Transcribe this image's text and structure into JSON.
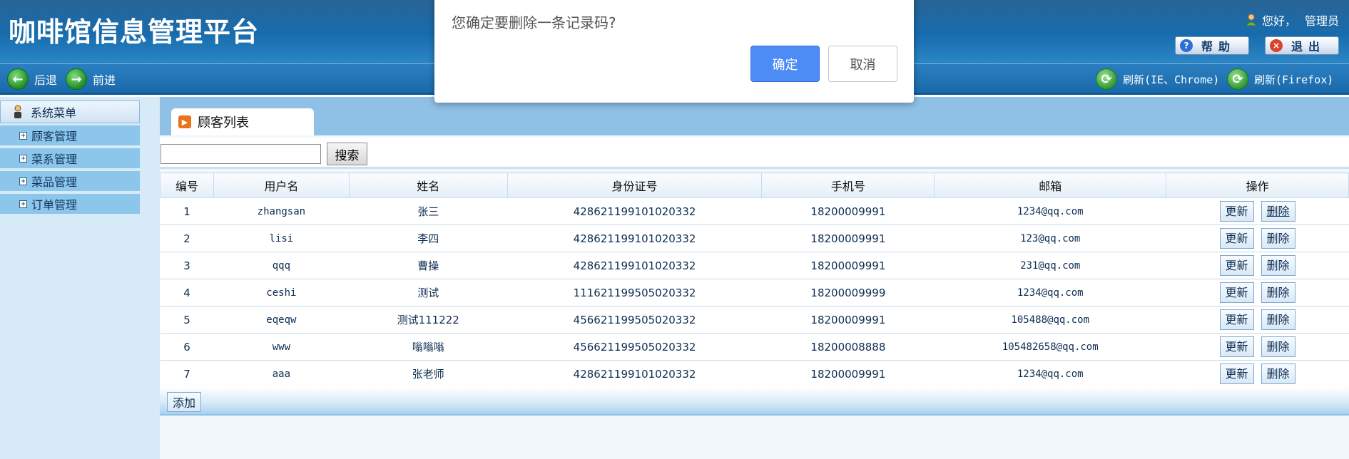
{
  "header": {
    "app_title": "咖啡馆信息管理平台",
    "greeting": "您好，",
    "username": "管理员",
    "help_label": "帮助",
    "logout_label": "退出"
  },
  "nav": {
    "back_label": "后退",
    "forward_label": "前进",
    "refresh_ie_label": "刷新(IE、Chrome)",
    "refresh_ff_label": "刷新(Firefox)"
  },
  "sidebar": {
    "menu_title": "系统菜单",
    "items": [
      {
        "label": "顾客管理"
      },
      {
        "label": "菜系管理"
      },
      {
        "label": "菜品管理"
      },
      {
        "label": "订单管理"
      }
    ]
  },
  "main": {
    "tab_label": "顾客列表",
    "search_placeholder": "",
    "search_value": "",
    "search_button": "搜索",
    "add_button": "添加",
    "columns": [
      "编号",
      "用户名",
      "姓名",
      "身份证号",
      "手机号",
      "邮箱",
      "操作"
    ],
    "rows": [
      {
        "id": "1",
        "username": "zhangsan",
        "name": "张三",
        "idcard": "428621199101020332",
        "phone": "18200009991",
        "email": "1234@qq.com"
      },
      {
        "id": "2",
        "username": "lisi",
        "name": "李四",
        "idcard": "428621199101020332",
        "phone": "18200009991",
        "email": "123@qq.com"
      },
      {
        "id": "3",
        "username": "qqq",
        "name": "曹操",
        "idcard": "428621199101020332",
        "phone": "18200009991",
        "email": "231@qq.com"
      },
      {
        "id": "4",
        "username": "ceshi",
        "name": "测试",
        "idcard": "111621199505020332",
        "phone": "18200009999",
        "email": "1234@qq.com"
      },
      {
        "id": "5",
        "username": "eqeqw",
        "name": "测试111222",
        "idcard": "456621199505020332",
        "phone": "18200009991",
        "email": "105488@qq.com"
      },
      {
        "id": "6",
        "username": "www",
        "name": "嗡嗡嗡",
        "idcard": "456621199505020332",
        "phone": "18200008888",
        "email": "105482658@qq.com"
      },
      {
        "id": "7",
        "username": "aaa",
        "name": "张老师",
        "idcard": "428621199101020332",
        "phone": "18200009991",
        "email": "1234@qq.com"
      }
    ],
    "update_label": "更新",
    "delete_label": "删除"
  },
  "dialog": {
    "message": "您确定要删除一条记录码?",
    "ok_label": "确定",
    "cancel_label": "取消"
  },
  "colors": {
    "header_blue": "#1467a8",
    "sidebar_item": "#8cc6ea",
    "dialog_ok": "#4d8cf5"
  }
}
